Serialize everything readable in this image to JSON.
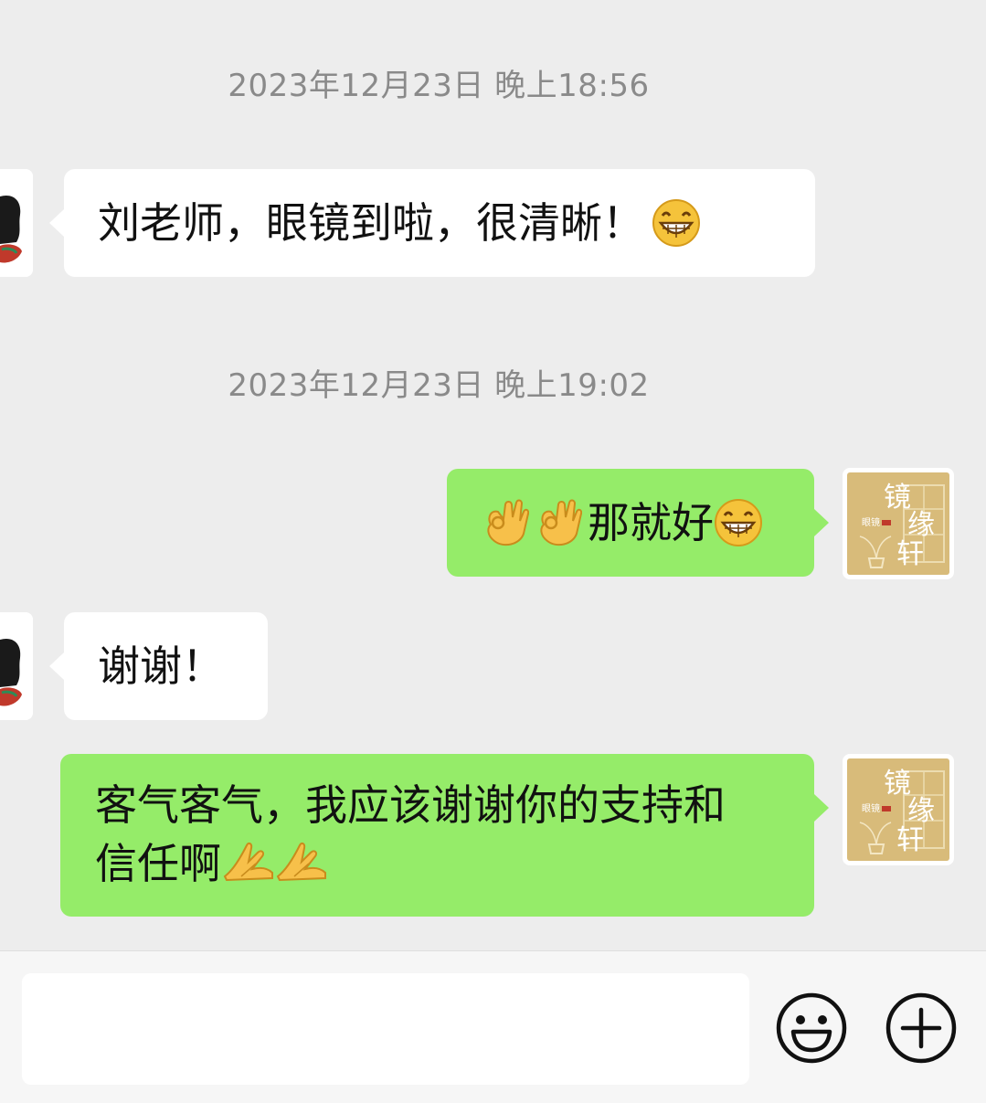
{
  "messages": [
    {
      "type": "timestamp",
      "text": "2023年12月23日 晚上18:56"
    },
    {
      "type": "message",
      "side": "left",
      "text": "刘老师，眼镜到啦，很清晰！",
      "emoji_suffix": "grin-emoji"
    },
    {
      "type": "timestamp",
      "text": "2023年12月23日 晚上19:02"
    },
    {
      "type": "message",
      "side": "right",
      "emoji_prefix": [
        "ok-hand-emoji",
        "ok-hand-emoji"
      ],
      "text": "那就好",
      "emoji_suffix": "grin-emoji"
    },
    {
      "type": "message",
      "side": "left",
      "text": "谢谢！"
    },
    {
      "type": "message",
      "side": "right",
      "text_line1": "客气客气，我应该谢谢你的支持和",
      "text_line2": "信任啊",
      "emoji_suffix": [
        "pray-emoji",
        "pray-emoji"
      ]
    }
  ],
  "shop_logo": {
    "text_main1": "镜",
    "text_main2": "缘",
    "text_main3": "轩",
    "text_small": "眼镜"
  },
  "input": {
    "value": "",
    "placeholder": ""
  },
  "icons": {
    "emoji_button": "smiley-icon",
    "plus_button": "plus-circle-icon"
  },
  "colors": {
    "background": "#ededed",
    "bubble_self": "#95ec69",
    "bubble_other": "#ffffff",
    "timestamp": "#8a8a8a"
  }
}
